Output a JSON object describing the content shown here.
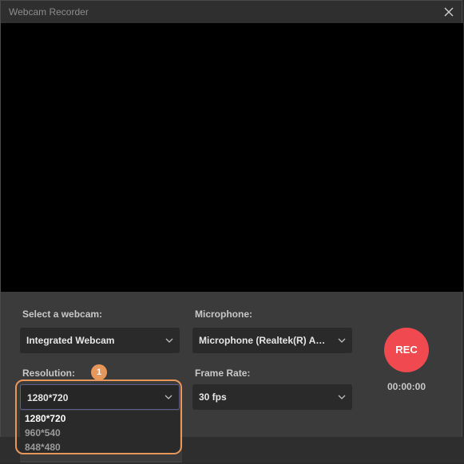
{
  "window": {
    "title": "Webcam Recorder"
  },
  "webcam": {
    "label": "Select a webcam:",
    "value": "Integrated Webcam"
  },
  "microphone": {
    "label": "Microphone:",
    "value": "Microphone (Realtek(R) Audi"
  },
  "resolution": {
    "label": "Resolution:",
    "value": "1280*720",
    "options": [
      "1280*720",
      "960*540",
      "848*480"
    ],
    "step_marker": "1"
  },
  "frame_rate": {
    "label": "Frame Rate:",
    "value": "30 fps"
  },
  "record": {
    "label": "REC",
    "timer": "00:00:00"
  },
  "colors": {
    "accent_rec": "#f04a50",
    "highlight": "#e8975b",
    "focus_border": "#5b5f8c"
  },
  "icons": [
    "close-icon",
    "chevron-down-icon"
  ]
}
